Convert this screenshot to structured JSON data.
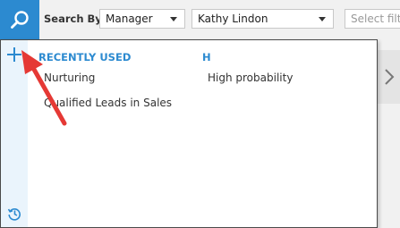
{
  "toolbar": {
    "search_icon": "search-icon",
    "search_by_label": "Search By",
    "search_by_value": "Manager",
    "person_value": "Kathy Lindon",
    "filter_placeholder": "Select filte"
  },
  "panel": {
    "add_icon": "plus-icon",
    "history_icon": "history-icon",
    "sections": [
      {
        "header": "RECENTLY USED",
        "items": [
          "Nurturing",
          "Qualified Leads in Sales"
        ]
      },
      {
        "header": "H",
        "items": [
          "High probability"
        ]
      }
    ]
  },
  "pager": {
    "next_icon": "chevron-right-icon"
  },
  "colors": {
    "accent": "#2c8ad0",
    "arrow": "#e53935",
    "rail": "#eaf4fc"
  }
}
